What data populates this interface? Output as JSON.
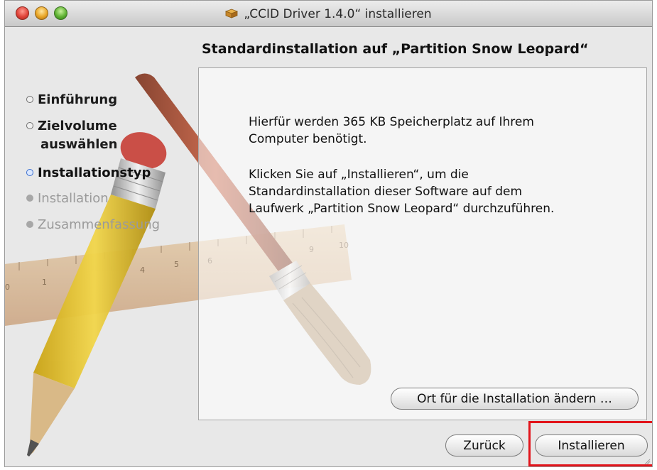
{
  "window": {
    "title": "„CCID Driver 1.4.0“ installieren"
  },
  "heading": "Standardinstallation auf „Partition Snow Leopard“",
  "steps": [
    {
      "label": "Einführung",
      "state": "done"
    },
    {
      "label": "Zielvolume",
      "label2": "auswählen",
      "state": "done"
    },
    {
      "label": "Installationstyp",
      "state": "current"
    },
    {
      "label": "Installation",
      "state": "todo"
    },
    {
      "label": "Zusammenfassung",
      "state": "todo"
    }
  ],
  "message": {
    "line1": "Hierfür werden 365 KB Speicherplatz auf Ihrem",
    "line2": "Computer benötigt.",
    "line3": "Klicken Sie auf „Installieren“, um die",
    "line4": "Standardinstallation dieser Software auf dem",
    "line5": "Laufwerk „Partition Snow Leopard“ durchzuführen."
  },
  "buttons": {
    "change_location": "Ort für die Installation ändern …",
    "back": "Zurück",
    "install": "Installieren"
  },
  "ruler_labels": [
    "0",
    "1",
    "4",
    "5",
    "6",
    "9",
    "10"
  ],
  "colors": {
    "highlight": "#e2141b",
    "step_current": "#3a6ed0",
    "step_inactive": "#9a9a9a"
  }
}
